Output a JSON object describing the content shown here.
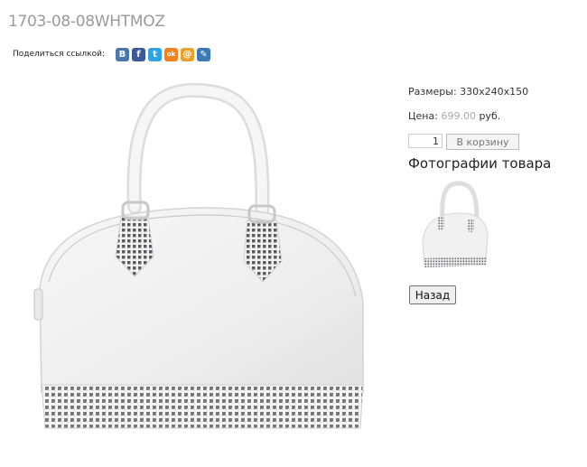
{
  "product": {
    "title": "1703-08-08WHTMOZ",
    "dimensions": "Размеры: 330х240х150",
    "price_label": "Цена: ",
    "price_value": "699.00",
    "price_currency": " руб."
  },
  "share": {
    "label": "Поделиться ссылкой:",
    "icons": [
      {
        "name": "vk-icon",
        "glyph": "В",
        "color": "#4a76a8"
      },
      {
        "name": "facebook-icon",
        "glyph": "f",
        "color": "#3b5998"
      },
      {
        "name": "twitter-icon",
        "glyph": "t",
        "color": "#2fa4e0"
      },
      {
        "name": "odnoklassniki-icon",
        "glyph": "ok",
        "color": "#f0831f"
      },
      {
        "name": "mailru-icon",
        "glyph": "@",
        "color": "#e8a12a"
      },
      {
        "name": "livejournal-icon",
        "glyph": "✎",
        "color": "#3b78b5"
      }
    ]
  },
  "cart": {
    "quantity": "1",
    "button_label": "В корзину"
  },
  "gallery": {
    "heading": "Фотографии товара"
  },
  "nav": {
    "back_label": "Назад"
  }
}
